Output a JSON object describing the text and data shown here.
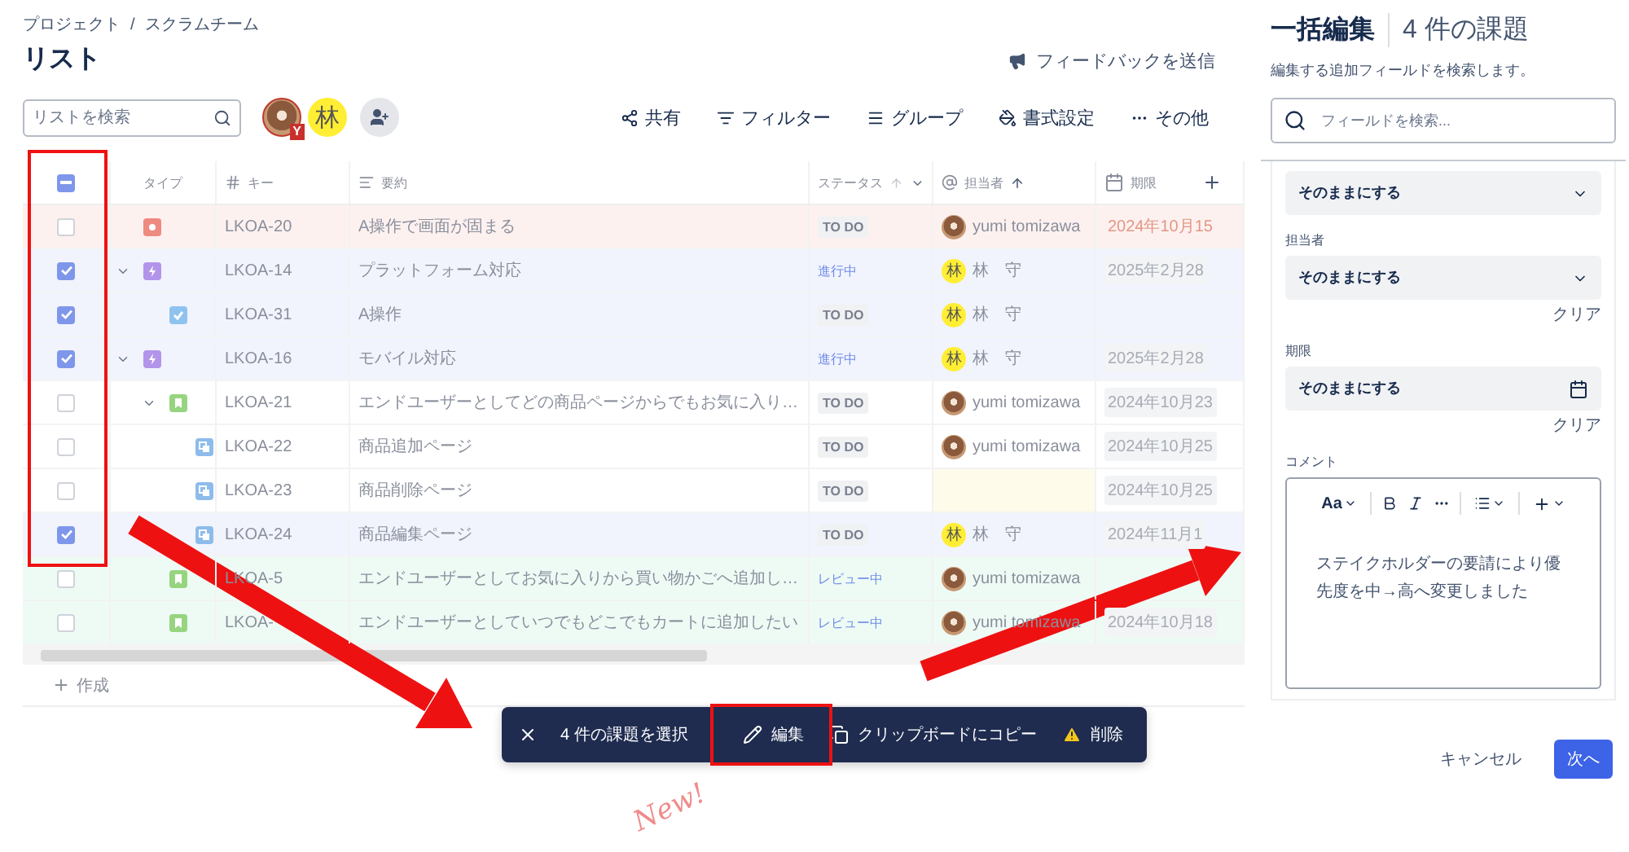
{
  "breadcrumb": {
    "items": [
      "プロジェクト",
      "スクラムチーム"
    ],
    "separator": "/"
  },
  "page_title": "リスト",
  "feedback_link": "フィードバックを送信",
  "search": {
    "placeholder": "リストを検索"
  },
  "header_avatars": [
    {
      "kind": "photo",
      "badge": "Y"
    },
    {
      "kind": "initial",
      "text": "林"
    }
  ],
  "toolbar": [
    {
      "kind": "share",
      "label": "共有"
    },
    {
      "kind": "filter",
      "label": "フィルター"
    },
    {
      "kind": "group",
      "label": "グループ"
    },
    {
      "kind": "format",
      "label": "書式設定"
    },
    {
      "kind": "more",
      "label": "その他"
    }
  ],
  "table": {
    "header_checkbox": {
      "indeterminate": true
    },
    "columns": [
      {
        "kind": "type",
        "label": "タイプ"
      },
      {
        "kind": "key",
        "label": "キー"
      },
      {
        "kind": "summary",
        "label": "要約"
      },
      {
        "kind": "status",
        "label": "ステータス",
        "sorted": false
      },
      {
        "kind": "assignee",
        "label": "担当者",
        "sorted": true
      },
      {
        "kind": "due",
        "label": "期限"
      }
    ],
    "rows": [
      {
        "key": "LKOA-20",
        "kind": "bug",
        "summary": "A操作で画面が固まる",
        "status": {
          "kind": "todo",
          "label": "TO DO"
        },
        "assignee": {
          "name": "yumi tomizawa",
          "kind": "photo"
        },
        "due": {
          "text": "2024年10月15",
          "overdue": true
        },
        "selected": false,
        "color": "#fdf1f0"
      },
      {
        "key": "LKOA-14",
        "kind": "epic",
        "summary": "プラットフォーム対応",
        "status": {
          "kind": "progress",
          "label": "進行中"
        },
        "assignee": {
          "name": "林　守",
          "kind": "initial",
          "initial": "林"
        },
        "due": {
          "text": "2025年2月28",
          "overdue": false
        },
        "selected": true,
        "expanded": true,
        "children": [
          {
            "key": "LKOA-31",
            "kind": "task",
            "summary": "A操作",
            "status": {
              "kind": "todo",
              "label": "TO DO"
            },
            "assignee": {
              "name": "林　守",
              "kind": "initial",
              "initial": "林"
            },
            "selected": true
          }
        ]
      },
      {
        "key": "LKOA-16",
        "kind": "epic",
        "summary": "モバイル対応",
        "status": {
          "kind": "progress",
          "label": "進行中"
        },
        "assignee": {
          "name": "林　守",
          "kind": "initial",
          "initial": "林"
        },
        "due": {
          "text": "2025年2月28",
          "overdue": false
        },
        "selected": true,
        "expanded": true,
        "children": [
          {
            "key": "LKOA-21",
            "kind": "story",
            "summary": "エンドユーザーとしてどの商品ページからでもお気に入り…",
            "status": {
              "kind": "todo",
              "label": "TO DO"
            },
            "assignee": {
              "name": "yumi tomizawa",
              "kind": "photo"
            },
            "due": {
              "text": "2024年10月23",
              "overdue": false
            },
            "selected": false,
            "expanded": true,
            "children": [
              {
                "key": "LKOA-22",
                "kind": "subtask",
                "summary": "商品追加ページ",
                "status": {
                  "kind": "todo",
                  "label": "TO DO"
                },
                "assignee": {
                  "name": "yumi tomizawa",
                  "kind": "photo"
                },
                "due": {
                  "text": "2024年10月25",
                  "overdue": false
                },
                "selected": false
              },
              {
                "key": "LKOA-23",
                "kind": "subtask",
                "summary": "商品削除ページ",
                "status": {
                  "kind": "todo",
                  "label": "TO DO"
                },
                "due": {
                  "text": "2024年10月25",
                  "overdue": false
                },
                "selected": false
              },
              {
                "key": "LKOA-24",
                "kind": "subtask",
                "summary": "商品編集ページ",
                "status": {
                  "kind": "todo",
                  "label": "TO DO"
                },
                "assignee": {
                  "name": "林　守",
                  "kind": "initial",
                  "initial": "林"
                },
                "due": {
                  "text": "2024年11月1",
                  "overdue": false
                },
                "selected": true
              }
            ]
          },
          {
            "key": "LKOA-5",
            "kind": "story",
            "summary": "エンドユーザーとしてお気に入りから買い物かごへ追加し…",
            "status": {
              "kind": "review",
              "label": "レビュー中"
            },
            "assignee": {
              "name": "yumi tomizawa",
              "kind": "photo"
            },
            "selected": false,
            "color": "#eefbf5"
          },
          {
            "key": "LKOA-",
            "kind": "story",
            "summary": "エンドユーザーとしていつでもどこでもカートに追加したい",
            "status": {
              "kind": "review",
              "label": "レビュー中"
            },
            "assignee": {
              "name": "yumi tomizawa",
              "kind": "photo"
            },
            "due": {
              "text": "2024年10月18",
              "overdue": false
            },
            "selected": false,
            "color": "#eefbf5"
          }
        ]
      }
    ]
  },
  "create_label": "作成",
  "bulk_bar": {
    "count_label": "4 件の課題を選択",
    "actions": [
      {
        "kind": "edit",
        "label": "編集"
      },
      {
        "kind": "copy",
        "label": "クリップボードにコピー"
      },
      {
        "kind": "delete",
        "label": "削除"
      }
    ]
  },
  "panel": {
    "title": "一括編集",
    "count": "4 件の課題",
    "hint": "編集する追加フィールドを検索します。",
    "search_placeholder": "フィールドを検索...",
    "fields": [
      {
        "kind": "select",
        "value": "そのままにする"
      },
      {
        "kind": "select",
        "label": "担当者",
        "value": "そのままにする",
        "clear": "クリア"
      },
      {
        "kind": "date",
        "label": "期限",
        "value": "そのままにする",
        "clear": "クリア"
      },
      {
        "kind": "editor",
        "label": "コメント",
        "font_button": "Aa",
        "text": "ステイクホルダーの要請により優先度を中→高へ変更しました"
      }
    ],
    "cancel": "キャンセル",
    "next": "次へ"
  },
  "annotation_note": "New!"
}
